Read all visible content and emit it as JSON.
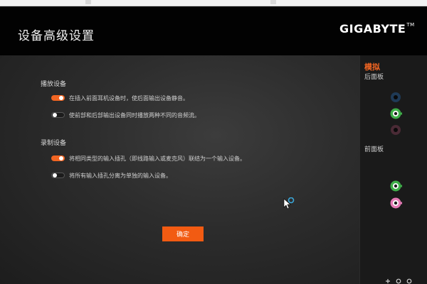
{
  "window": {
    "title": "设备高级设置",
    "brand": "GIGABYTE",
    "brand_tm": "TM"
  },
  "playback": {
    "section_label": "播放设备",
    "options": [
      {
        "label": "在插入前面耳机设备时，使后面输出设备静音。",
        "enabled": true
      },
      {
        "label": "使前部和后部输出设备同时播放两种不同的音频流。",
        "enabled": false
      }
    ]
  },
  "recording": {
    "section_label": "录制设备",
    "options": [
      {
        "label": "将相同类型的输入插孔（即线路输入或麦克风）联结为一个输入设备。",
        "enabled": true
      },
      {
        "label": "将所有输入插孔分离为单独的输入设备。",
        "enabled": false
      }
    ]
  },
  "confirm_label": "确定",
  "side_panel": {
    "title": "模拟",
    "rear_label": "后面板",
    "front_label": "前面板",
    "rear_jacks": [
      {
        "icon": "rear-jack-blue-icon",
        "color": "#1f3a56",
        "active": false
      },
      {
        "icon": "rear-jack-green-icon",
        "color": "#3fae49",
        "active": true
      },
      {
        "icon": "rear-jack-pink-icon",
        "color": "#4a2a35",
        "active": false
      }
    ],
    "front_jacks": [
      {
        "icon": "front-jack-green-icon",
        "color": "#3fae49",
        "active": true
      },
      {
        "icon": "front-jack-pink-icon",
        "color": "#e57ab5",
        "active": true
      }
    ]
  },
  "colors": {
    "accent": "#f26522",
    "header_bg": "#020202",
    "toggle_on": "#f26522"
  }
}
